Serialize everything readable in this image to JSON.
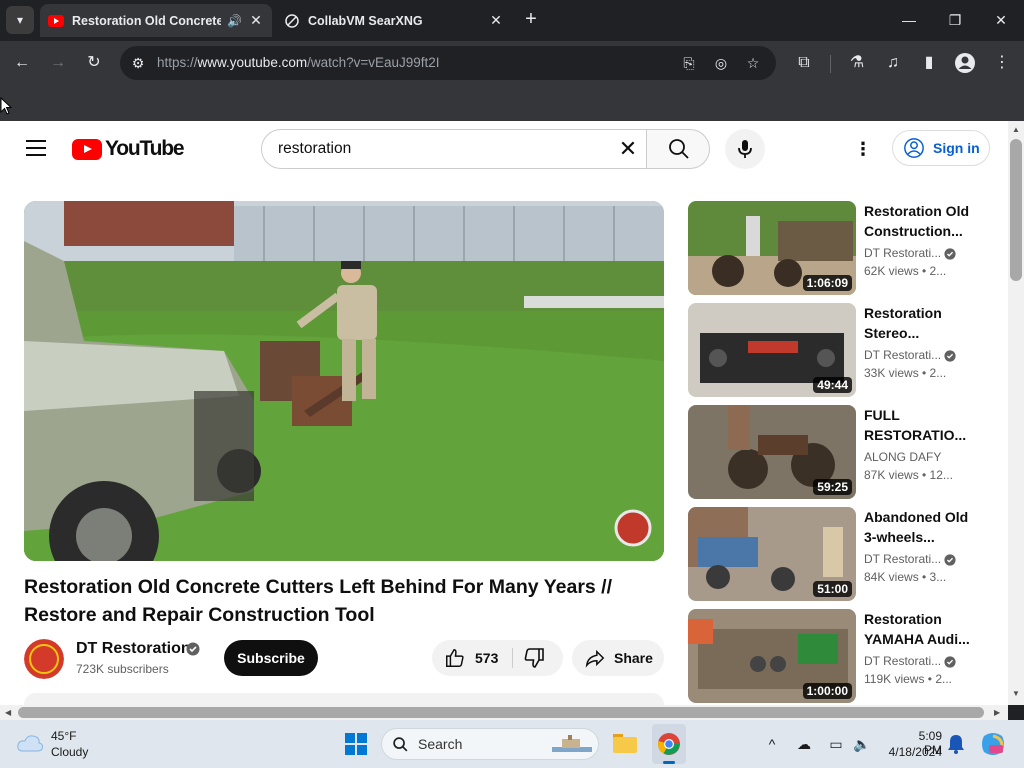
{
  "browser": {
    "tabs": [
      {
        "title": "Restoration Old Concrete C",
        "active": true
      },
      {
        "title": "CollabVM SearXNG",
        "active": false
      }
    ],
    "url": {
      "scheme": "https://",
      "host": "www.youtube.com",
      "path": "/watch?v=vEauJ99ft2I"
    }
  },
  "youtube": {
    "logo_text": "YouTube",
    "search_value": "restoration",
    "signin_label": "Sign in",
    "video": {
      "title": "Restoration Old Concrete Cutters Left Behind For Many Years // Restore and Repair Construction Tool",
      "channel": "DT Restoration",
      "subscribers": "723K subscribers",
      "subscribe_label": "Subscribe",
      "likes": "573",
      "share_label": "Share"
    },
    "recommendations": [
      {
        "title": "Restoration Old Construction...",
        "channel": "DT Restorati...",
        "verified": true,
        "meta": "62K views • 2...",
        "duration": "1:06:09"
      },
      {
        "title": "Restoration Stereo...",
        "channel": "DT Restorati...",
        "verified": true,
        "meta": "33K views • 2...",
        "duration": "49:44"
      },
      {
        "title": "FULL RESTORATIO...",
        "channel": "ALONG DAFY",
        "verified": false,
        "meta": "87K views • 12...",
        "duration": "59:25"
      },
      {
        "title": "Abandoned Old 3-wheels...",
        "channel": "DT Restorati...",
        "verified": true,
        "meta": "84K views • 3...",
        "duration": "51:00"
      },
      {
        "title": "Restoration YAMAHA Audi...",
        "channel": "DT Restorati...",
        "verified": true,
        "meta": "119K views • 2...",
        "duration": "1:00:00"
      }
    ]
  },
  "taskbar": {
    "weather_temp": "45°F",
    "weather_cond": "Cloudy",
    "search_label": "Search",
    "time": "5:09 PM",
    "date": "4/18/2024"
  },
  "colors": {
    "youtube_red": "#ff0000",
    "link_blue": "#065fd4",
    "chrome_dark": "#202124"
  }
}
